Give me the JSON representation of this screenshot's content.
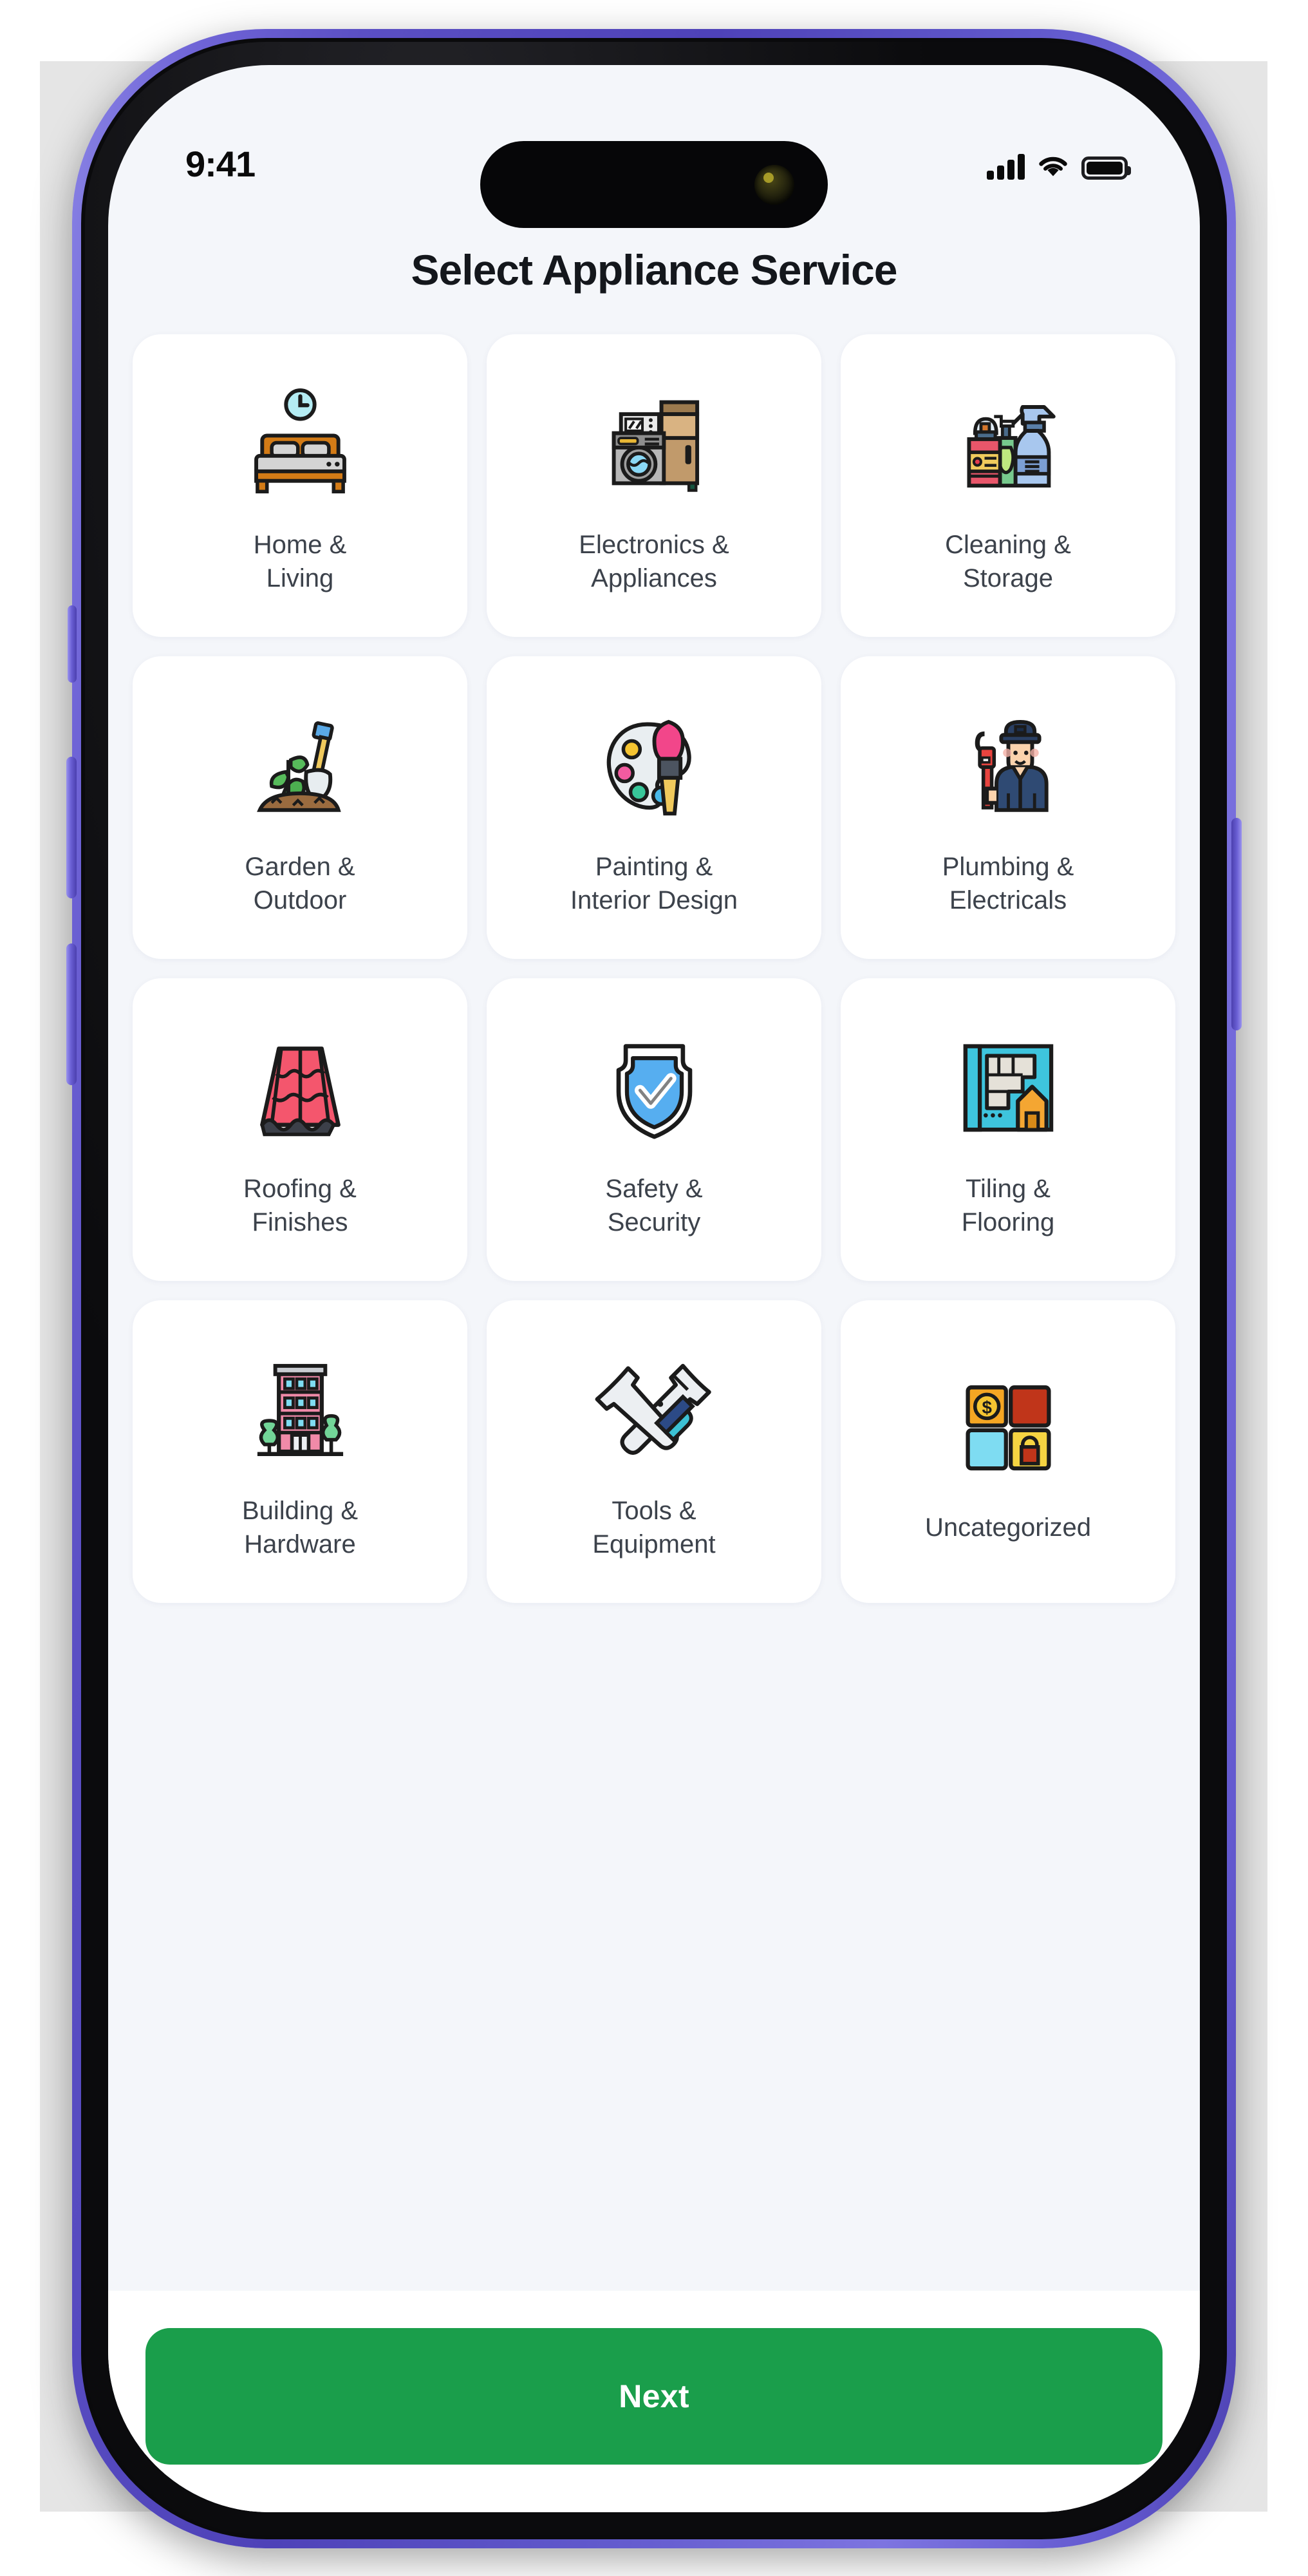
{
  "device": {
    "frame_color": "#5b4fc4",
    "bezel_color": "#0a0a0c",
    "screen_bg": "#f4f6fa"
  },
  "status_bar": {
    "time": "9:41",
    "icons": [
      "cellular-signal-icon",
      "wifi-icon",
      "battery-icon"
    ],
    "battery_level": 100
  },
  "header": {
    "title": "Select Appliance Service"
  },
  "grid": {
    "columns": 3,
    "items": [
      {
        "label": "Home &\nLiving",
        "icon": "bed-clock-icon"
      },
      {
        "label": "Electronics &\nAppliances",
        "icon": "washing-machine-fridge-icon"
      },
      {
        "label": "Cleaning &\nStorage",
        "icon": "spray-bottles-icon"
      },
      {
        "label": "Garden &\nOutdoor",
        "icon": "plant-shovel-icon"
      },
      {
        "label": "Painting &\nInterior Design",
        "icon": "palette-brush-icon"
      },
      {
        "label": "Plumbing &\nElectricals",
        "icon": "plumber-icon"
      },
      {
        "label": "Roofing &\nFinishes",
        "icon": "roof-tiles-icon"
      },
      {
        "label": "Safety &\nSecurity",
        "icon": "shield-check-icon"
      },
      {
        "label": "Tiling &\nFlooring",
        "icon": "tiling-house-icon"
      },
      {
        "label": "Building &\nHardware",
        "icon": "apartment-building-icon"
      },
      {
        "label": "Tools &\nEquipment",
        "icon": "wrench-screwdriver-icon"
      },
      {
        "label": "Uncategorized",
        "icon": "four-squares-icon"
      }
    ]
  },
  "footer": {
    "next_label": "Next",
    "next_color": "#1a9e4b"
  }
}
